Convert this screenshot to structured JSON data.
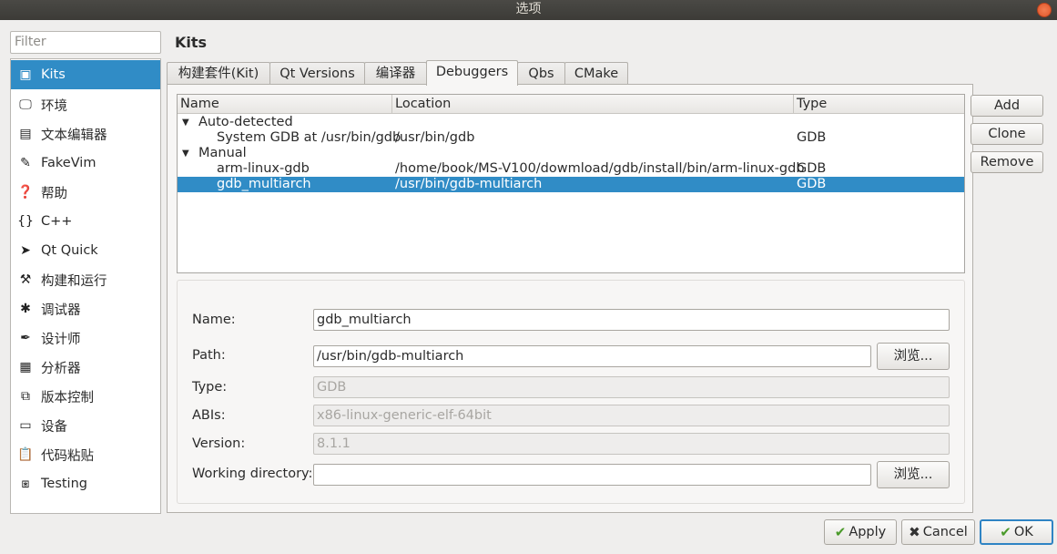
{
  "window": {
    "title": "选项"
  },
  "filter": {
    "placeholder": "Filter"
  },
  "sidebar": {
    "items": [
      {
        "label": "Kits",
        "icon": "kits-icon",
        "glyph": "▣"
      },
      {
        "label": "环境",
        "icon": "monitor-icon",
        "glyph": "🖵"
      },
      {
        "label": "文本编辑器",
        "icon": "text-editor-icon",
        "glyph": "▤"
      },
      {
        "label": "FakeVim",
        "icon": "fakevim-icon",
        "glyph": "✎"
      },
      {
        "label": "帮助",
        "icon": "help-icon",
        "glyph": "❓"
      },
      {
        "label": "C++",
        "icon": "cpp-braces-icon",
        "glyph": "{}"
      },
      {
        "label": "Qt Quick",
        "icon": "qt-quick-icon",
        "glyph": "➤"
      },
      {
        "label": "构建和运行",
        "icon": "hammer-icon",
        "glyph": "⚒"
      },
      {
        "label": "调试器",
        "icon": "bug-icon",
        "glyph": "✱"
      },
      {
        "label": "设计师",
        "icon": "pen-icon",
        "glyph": "✒"
      },
      {
        "label": "分析器",
        "icon": "analyzer-icon",
        "glyph": "▦"
      },
      {
        "label": "版本控制",
        "icon": "version-control-icon",
        "glyph": "⧉"
      },
      {
        "label": "设备",
        "icon": "device-icon",
        "glyph": "▭"
      },
      {
        "label": "代码粘贴",
        "icon": "code-paste-icon",
        "glyph": "📋"
      },
      {
        "label": "Testing",
        "icon": "testing-icon",
        "glyph": "⧆"
      }
    ]
  },
  "page": {
    "title": "Kits"
  },
  "tabs": [
    "构建套件(Kit)",
    "Qt Versions",
    "编译器",
    "Debuggers",
    "Qbs",
    "CMake"
  ],
  "table": {
    "headers": [
      "Name",
      "Location",
      "Type"
    ],
    "groups": [
      {
        "label": "Auto-detected",
        "rows": [
          {
            "name": "System GDB at /usr/bin/gdb",
            "location": "/usr/bin/gdb",
            "type": "GDB"
          }
        ]
      },
      {
        "label": "Manual",
        "rows": [
          {
            "name": "arm-linux-gdb",
            "location": "/home/book/MS-V100/dowmload/gdb/install/bin/arm-linux-gdb",
            "type": "GDB"
          },
          {
            "name": "gdb_multiarch",
            "location": "/usr/bin/gdb-multiarch",
            "type": "GDB"
          }
        ]
      }
    ]
  },
  "buttons": {
    "add": "Add",
    "clone": "Clone",
    "remove": "Remove",
    "browse": "浏览...",
    "apply": "Apply",
    "cancel": "Cancel",
    "ok": "OK"
  },
  "details": {
    "name_label": "Name:",
    "name_value": "gdb_multiarch",
    "path_label": "Path:",
    "path_value": "/usr/bin/gdb-multiarch",
    "type_label": "Type:",
    "type_value": "GDB",
    "abis_label": "ABIs:",
    "abis_value": "x86-linux-generic-elf-64bit",
    "version_label": "Version:",
    "version_value": "8.1.1",
    "workdir_label": "Working directory:",
    "workdir_value": ""
  },
  "colors": {
    "selection": "#308cc6",
    "titlebar": "#3c3b37"
  }
}
